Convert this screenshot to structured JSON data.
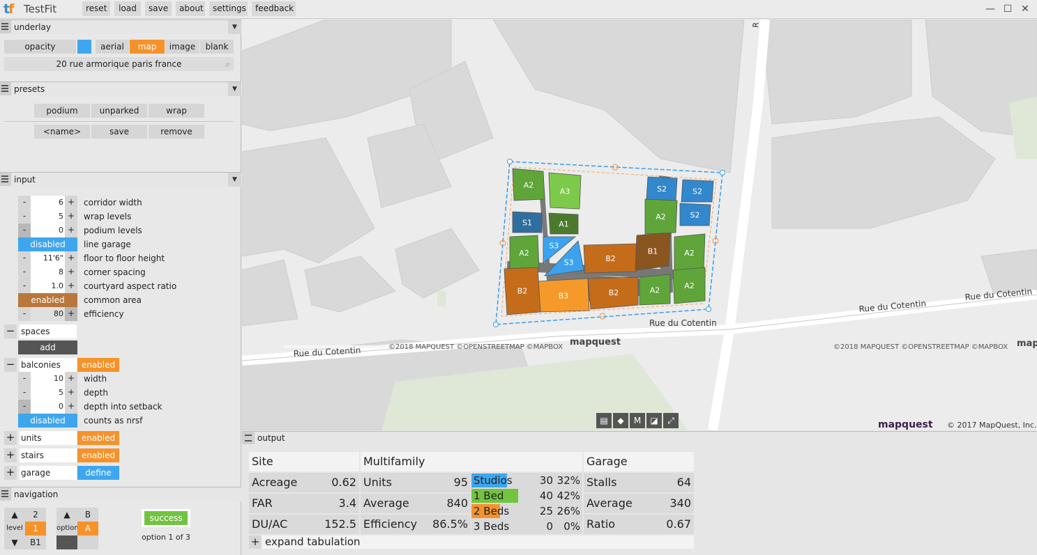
{
  "app": {
    "logo_t": "t",
    "logo_f": "f",
    "title": "TestFit"
  },
  "toolbar": [
    "reset",
    "load",
    "save",
    "about",
    "settings",
    "feedback"
  ],
  "window": {
    "minimize": "—",
    "maximize": "☐",
    "close": "✕"
  },
  "underlay": {
    "title": "underlay",
    "opacity_label": "opacity",
    "modes": [
      "aerial",
      "map",
      "image",
      "blank"
    ],
    "selected_mode": "map",
    "address": "20 rue armorique paris france"
  },
  "presets": {
    "title": "presets",
    "items": [
      "podium",
      "unparked",
      "wrap"
    ],
    "name_placeholder": "<name>",
    "save": "save",
    "remove": "remove"
  },
  "input": {
    "title": "input",
    "rows": [
      {
        "value": "6",
        "label": "corridor width"
      },
      {
        "value": "5",
        "label": "wrap levels"
      },
      {
        "value": "0",
        "label": "podium levels"
      },
      {
        "toggle": "disabled",
        "label": "line garage"
      },
      {
        "value": "11'6\"",
        "label": "floor to floor height"
      },
      {
        "value": "8",
        "label": "corner spacing"
      },
      {
        "value": "1.0",
        "label": "courtyard aspect ratio"
      },
      {
        "toggle": "enabled",
        "label": "common area"
      },
      {
        "value": "80",
        "label": "efficiency"
      }
    ],
    "spaces": {
      "name": "spaces",
      "add": "add"
    },
    "balconies": {
      "name": "balconies",
      "status": "enabled",
      "rows": [
        {
          "value": "10",
          "label": "width"
        },
        {
          "value": "5",
          "label": "depth"
        },
        {
          "value": "0",
          "label": "depth into setback"
        }
      ],
      "nrsf_toggle": "disabled",
      "nrsf_label": "counts as nrsf"
    },
    "units": {
      "name": "units",
      "status": "enabled"
    },
    "stairs": {
      "name": "stairs",
      "status": "enabled"
    },
    "garage": {
      "name": "garage",
      "status": "define"
    }
  },
  "navigation": {
    "title": "navigation",
    "levels": [
      "2",
      "1",
      "B1"
    ],
    "level_label": "level",
    "selected_level": "1",
    "options": [
      "B",
      "A"
    ],
    "option_label": "option",
    "selected_option": "A",
    "status": "success",
    "option_text": "option 1 of 3"
  },
  "map": {
    "streets": [
      "Rue du Cotentin",
      "Rue du Cotentin",
      "Rue du Cotentin",
      "Rue du Cotentin",
      "R"
    ],
    "attribution": "©2018 MAPQUEST ©OPENSTREETMAP ©MAPBOX",
    "attribution2": "©2018 MAPQUEST ©OPENSTREETMAP ©MAPBOX",
    "brand": "mapquest",
    "brand2": "mapquest",
    "brand3": "mapq",
    "copyright": "© 2017 MapQuest, Inc.",
    "tools": [
      "list-icon",
      "cube-icon",
      "M",
      "measure-icon",
      "fullscreen-icon"
    ],
    "units": [
      {
        "label": "A2",
        "color": "#5fa53a"
      },
      {
        "label": "A3",
        "color": "#7dc94a"
      },
      {
        "label": "S1",
        "color": "#2f6f9f"
      },
      {
        "label": "A1",
        "color": "#4c7a2c"
      },
      {
        "label": "A2",
        "color": "#5fa53a"
      },
      {
        "label": "S3",
        "color": "#3ba3ee"
      },
      {
        "label": "S3",
        "color": "#3ba3ee"
      },
      {
        "label": "B2",
        "color": "#c56c1b"
      },
      {
        "label": "B3",
        "color": "#f59a2a"
      },
      {
        "label": "B2",
        "color": "#c56c1b"
      },
      {
        "label": "B2",
        "color": "#c56c1b"
      },
      {
        "label": "B1",
        "color": "#8b5520"
      },
      {
        "label": "S2",
        "color": "#3287cd"
      },
      {
        "label": "S2",
        "color": "#3287cd"
      },
      {
        "label": "S2",
        "color": "#3287cd"
      },
      {
        "label": "A2",
        "color": "#5fa53a"
      },
      {
        "label": "A2",
        "color": "#5fa53a"
      },
      {
        "label": "A2",
        "color": "#5fa53a"
      },
      {
        "label": "A2",
        "color": "#5fa53a"
      }
    ]
  },
  "output": {
    "title": "output",
    "site": {
      "header": "Site",
      "rows": [
        {
          "label": "Acreage",
          "value": "0.62"
        },
        {
          "label": "FAR",
          "value": "3.4"
        },
        {
          "label": "DU/AC",
          "value": "152.5"
        }
      ]
    },
    "multifamily": {
      "header": "Multifamily",
      "rows": [
        {
          "label": "Units",
          "value": "95"
        },
        {
          "label": "Average",
          "value": "840"
        },
        {
          "label": "Efficiency",
          "value": "86.5%"
        }
      ],
      "mix": [
        {
          "label": "Studios",
          "count": "30",
          "pct": "32%",
          "color": "#3ea6ee",
          "fill": 0.32
        },
        {
          "label": "1 Bed",
          "count": "40",
          "pct": "42%",
          "color": "#72c440",
          "fill": 0.42
        },
        {
          "label": "2 Beds",
          "count": "25",
          "pct": "26%",
          "color": "#f5922a",
          "fill": 0.26
        },
        {
          "label": "3 Beds",
          "count": "0",
          "pct": "0%",
          "color": "#c56c1b",
          "fill": 0
        }
      ]
    },
    "garage": {
      "header": "Garage",
      "rows": [
        {
          "label": "Stalls",
          "value": "64"
        },
        {
          "label": "Average",
          "value": "340"
        },
        {
          "label": "Ratio",
          "value": "0.67"
        }
      ]
    },
    "expand": "expand tabulation"
  }
}
